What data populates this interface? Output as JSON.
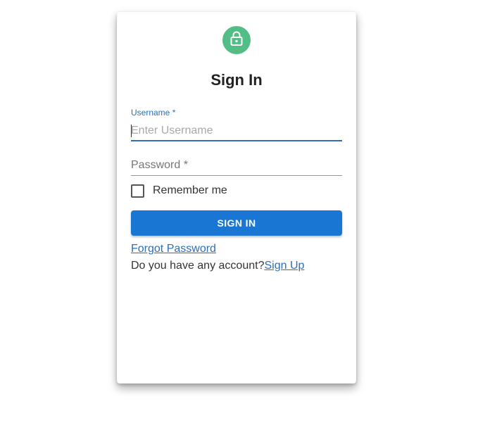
{
  "card": {
    "title": "Sign In",
    "avatar_icon": "lock-icon",
    "accent_color": "#52bd84"
  },
  "username": {
    "label": "Username *",
    "placeholder": "Enter Username",
    "value": ""
  },
  "password": {
    "placeholder": "Password *",
    "value": ""
  },
  "remember": {
    "label": "Remember me",
    "checked": false
  },
  "button": {
    "label": "SIGN IN",
    "color": "#1976d2"
  },
  "links": {
    "forgot": "Forgot Password",
    "account_prompt": "Do you have any account?",
    "signup": "Sign Up"
  }
}
